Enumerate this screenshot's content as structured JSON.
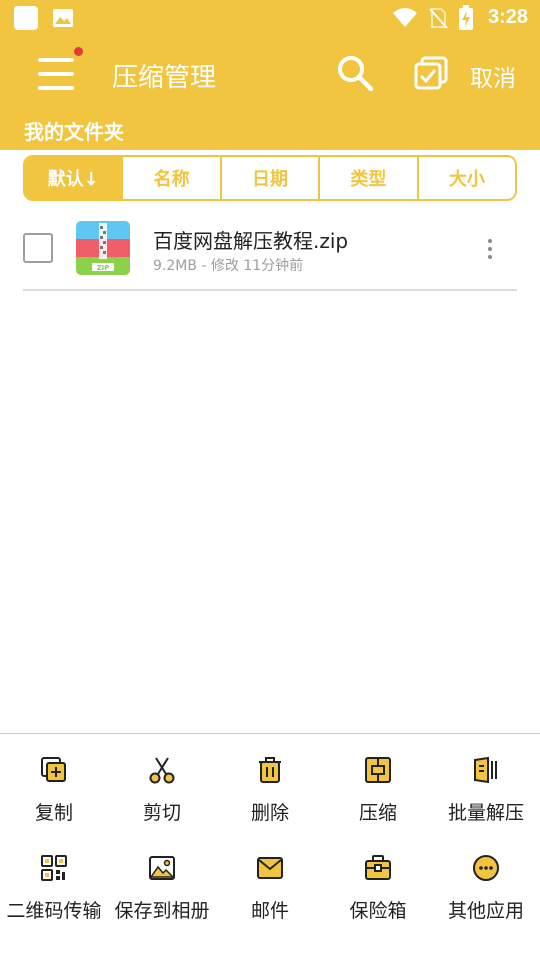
{
  "status_bar": {
    "time": "3:28"
  },
  "app_bar": {
    "title": "压缩管理",
    "cancel_label": "取消"
  },
  "folder": {
    "title": "我的文件夹"
  },
  "sort_tabs": [
    {
      "label": "默认↓",
      "active": true
    },
    {
      "label": "名称",
      "active": false
    },
    {
      "label": "日期",
      "active": false
    },
    {
      "label": "类型",
      "active": false
    },
    {
      "label": "大小",
      "active": false
    }
  ],
  "files": [
    {
      "name": "百度网盘解压教程.zip",
      "meta": "9.2MB - 修改 11分钟前",
      "icon": "zip-file-icon",
      "checked": false
    }
  ],
  "actions_row1": [
    {
      "label": "复制",
      "icon": "copy-icon"
    },
    {
      "label": "剪切",
      "icon": "scissors-icon"
    },
    {
      "label": "删除",
      "icon": "trash-icon"
    },
    {
      "label": "压缩",
      "icon": "compress-icon"
    },
    {
      "label": "批量解压",
      "icon": "batch-extract-icon"
    }
  ],
  "actions_row2": [
    {
      "label": "二维码传输",
      "icon": "qr-code-icon"
    },
    {
      "label": "保存到相册",
      "icon": "image-icon"
    },
    {
      "label": "邮件",
      "icon": "mail-icon"
    },
    {
      "label": "保险箱",
      "icon": "safe-box-icon"
    },
    {
      "label": "其他应用",
      "icon": "more-apps-icon"
    }
  ],
  "colors": {
    "accent": "#f2c540",
    "notification_dot": "#e53935"
  }
}
